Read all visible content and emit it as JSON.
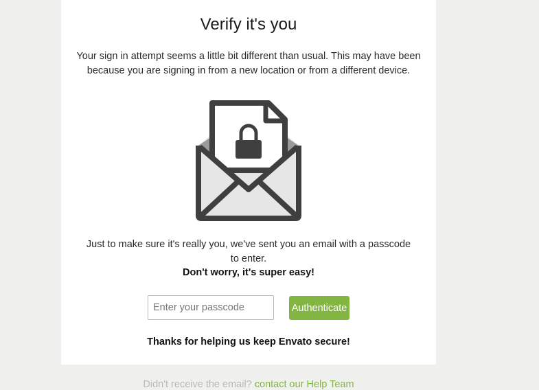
{
  "heading": "Verify it's you",
  "intro_text": "Your sign in attempt seems a little bit different than usual. This may have been because you are signing in from a new location or from a different device.",
  "illustration": {
    "icon": "envelope-lock-icon"
  },
  "sent_message": "Just to make sure it's really you, we've sent you an email with a passcode to enter.",
  "reassurance": "Don't worry, it's super easy!",
  "form": {
    "passcode_placeholder": "Enter your passcode",
    "passcode_value": "",
    "submit_label": "Authenticate"
  },
  "thanks_text": "Thanks for helping us keep Envato secure!",
  "footer": {
    "prompt": "Didn't receive the email?",
    "link_text": "contact our Help Team"
  },
  "colors": {
    "accent": "#82b541",
    "page_background": "#f0f0ee",
    "card_background": "#ffffff",
    "icon_dark": "#3f3f3f",
    "icon_light": "#e6e6e6"
  }
}
